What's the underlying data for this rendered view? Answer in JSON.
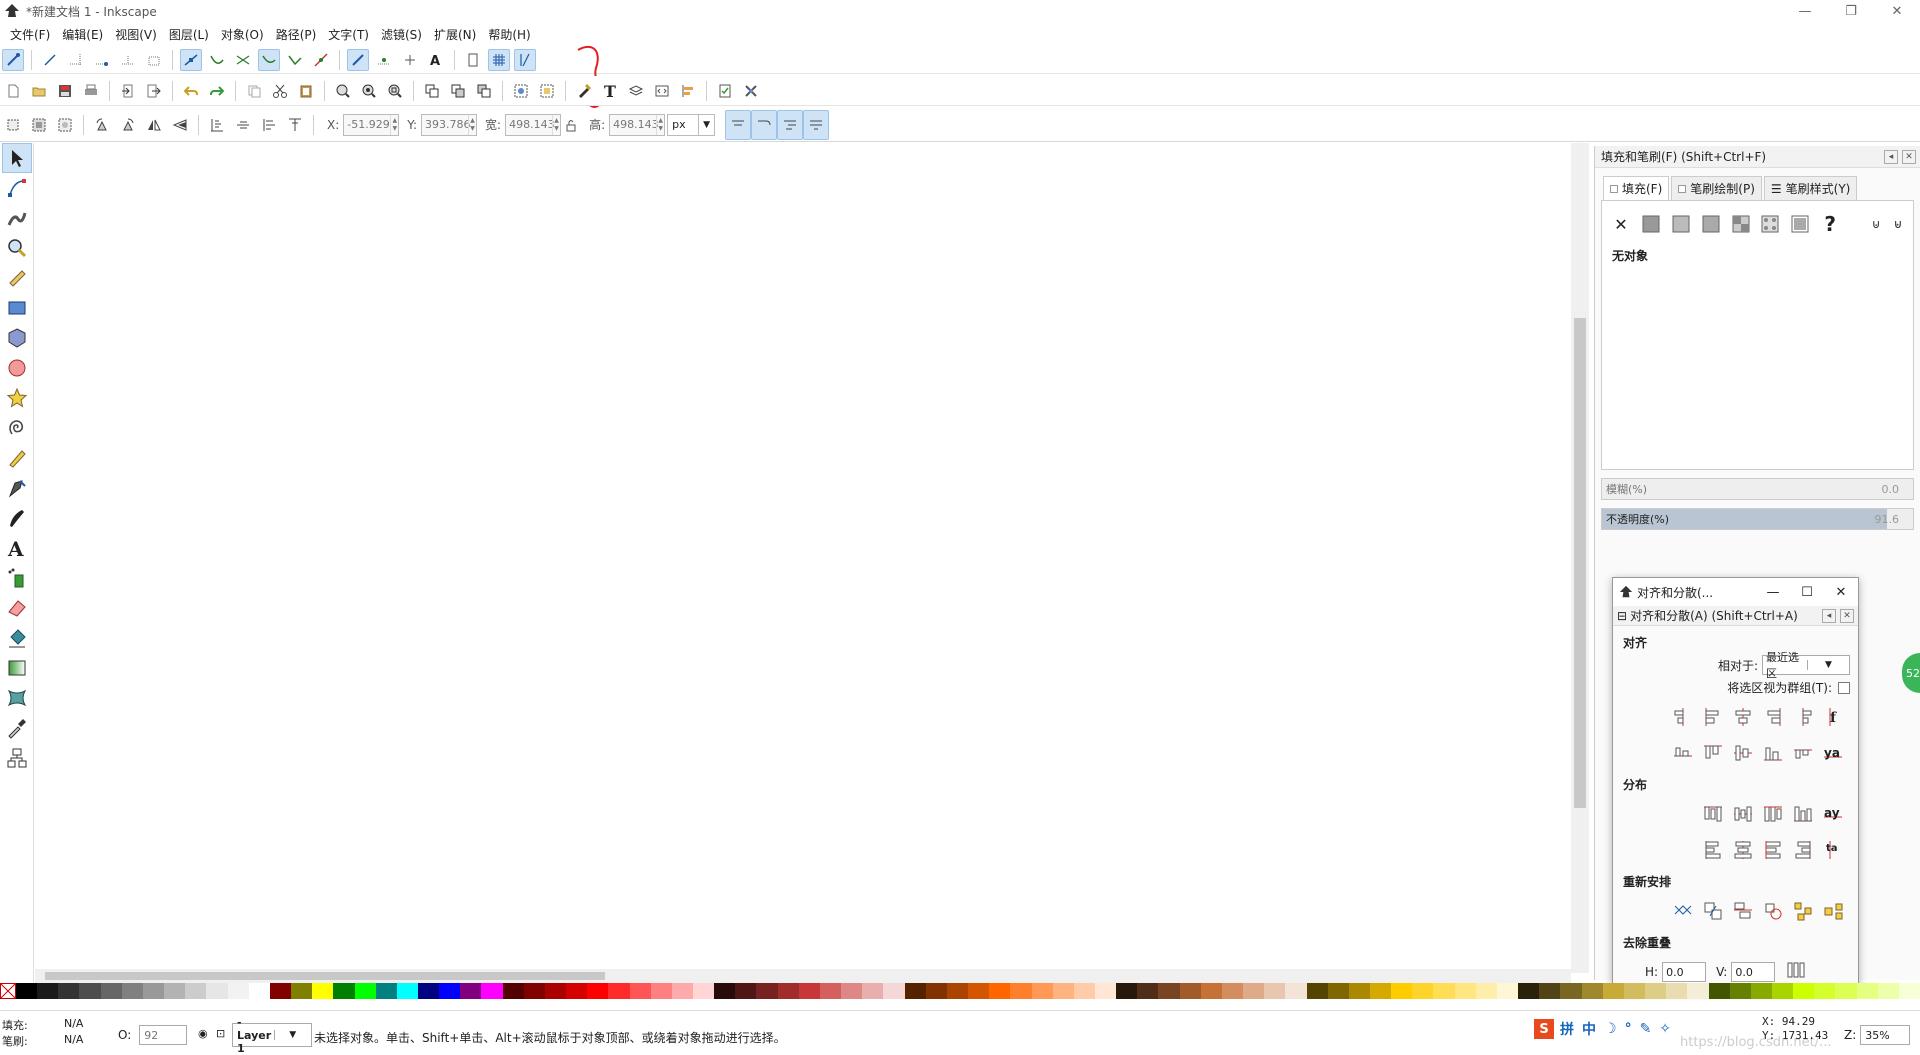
{
  "window": {
    "title": "*新建文档 1 - Inkscape",
    "min": "—",
    "restore": "❐",
    "close": "✕"
  },
  "menu": [
    "文件(F)",
    "编辑(E)",
    "视图(V)",
    "图层(L)",
    "对象(O)",
    "路径(P)",
    "文字(T)",
    "滤镜(S)",
    "扩展(N)",
    "帮助(H)"
  ],
  "toolbar3": {
    "x_label": "X:",
    "x_value": "-51.929",
    "y_label": "Y:",
    "y_value": "393.786",
    "w_label": "宽:",
    "w_value": "498.143",
    "h_label": "高:",
    "h_value": "498.143",
    "unit": "px"
  },
  "fill_panel": {
    "title": "填充和笔刷(F) (Shift+Ctrl+F)",
    "tabs": [
      "填充(F)",
      "笔刷绘制(P)",
      "笔刷样式(Y)"
    ],
    "no_object": "无对象",
    "blur_label": "模糊(%)",
    "blur_value": "0.0",
    "opacity_label": "不透明度(%)",
    "opacity_value": "91.6",
    "opacity_fraction": 0.916
  },
  "align_dialog": {
    "window_title": "对齐和分散(...",
    "dock_title": "对齐和分散(A) (Shift+Ctrl+A)",
    "section_align": "对齐",
    "relative_label": "相对于:",
    "relative_value": "最近选区",
    "treat_group_label": "将选区视为群组(T):",
    "section_distribute": "分布",
    "section_rearrange": "重新安排",
    "section_overlap": "去除重叠",
    "h_label": "H:",
    "h_value": "0.0",
    "v_label": "V:",
    "v_value": "0.0"
  },
  "status": {
    "fill_label": "填充:",
    "fill_value": "N/A",
    "stroke_label": "笔刷:",
    "stroke_value": "N/A",
    "opacity_label": "O:",
    "opacity_value": "92",
    "layer": "-Layer 1",
    "message": "未选择对象。单击、Shift+单击、Alt+滚动鼠标于对象顶部、或绕着对象拖动进行选择。",
    "x_coord": "X:     94.29",
    "y_coord": "Y: 1731.43",
    "zoom_label": "Z:",
    "zoom_value": "35%",
    "watermark": "https://blog.csdn.net/..."
  },
  "ime": {
    "logo": "S",
    "items": [
      "拼",
      "中",
      "☽",
      "°",
      "✎",
      "✧"
    ]
  },
  "bubble_text": "52",
  "colors": {
    "accent": "#cfe3f7",
    "accent_border": "#9ec3e8"
  },
  "palette": [
    "#000000",
    "#1a1a1a",
    "#333333",
    "#4d4d4d",
    "#666666",
    "#808080",
    "#999999",
    "#b3b3b3",
    "#cccccc",
    "#e6e6e6",
    "#f2f2f2",
    "#ffffff",
    "#800000",
    "#808000",
    "#ffff00",
    "#008000",
    "#00ff00",
    "#008080",
    "#00ffff",
    "#000080",
    "#0000ff",
    "#800080",
    "#ff00ff",
    "#550000",
    "#800000",
    "#aa0000",
    "#d40000",
    "#ff0000",
    "#ff2a2a",
    "#ff5555",
    "#ff8080",
    "#ffaaaa",
    "#ffd5d5",
    "#280b0b",
    "#501616",
    "#782121",
    "#a02c2c",
    "#c83737",
    "#d35f5f",
    "#de8787",
    "#e9afaf",
    "#f4d7d7",
    "#552200",
    "#803300",
    "#aa4400",
    "#d45500",
    "#ff6600",
    "#ff7f2a",
    "#ff9955",
    "#ffb380",
    "#ffccaa",
    "#ffe6d5",
    "#28170b",
    "#502d16",
    "#784421",
    "#a05a2c",
    "#c87137",
    "#d38d5f",
    "#deaa87",
    "#e9c6af",
    "#f4e3d7",
    "#554400",
    "#806600",
    "#aa8800",
    "#d4aa00",
    "#ffcc00",
    "#ffd42a",
    "#ffdd55",
    "#ffe680",
    "#ffeeaa",
    "#fff6d5",
    "#28220b",
    "#504416",
    "#786721",
    "#a0892c",
    "#c8ab37",
    "#d3bc5f",
    "#decd87",
    "#e9ddaf",
    "#f4eed7",
    "#445500",
    "#668000",
    "#88aa00",
    "#aad400",
    "#ccff00",
    "#d4ff2a",
    "#ddff55",
    "#e5ff80",
    "#eeffaa",
    "#f6ffd5"
  ]
}
